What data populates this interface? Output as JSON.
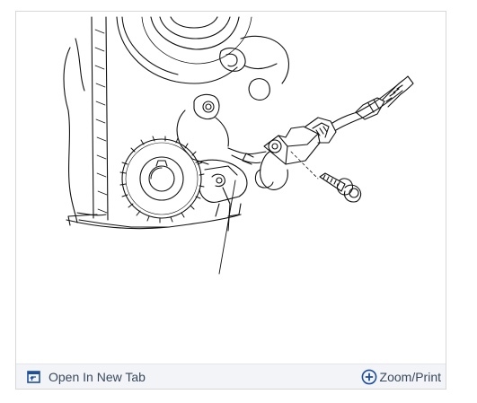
{
  "toolbar": {
    "open_label": "Open In New Tab",
    "zoom_label": "Zoom/Print",
    "open_icon": "open-in-new-tab-icon",
    "zoom_icon": "zoom-plus-icon",
    "accent_color": "#1f4e9a"
  }
}
